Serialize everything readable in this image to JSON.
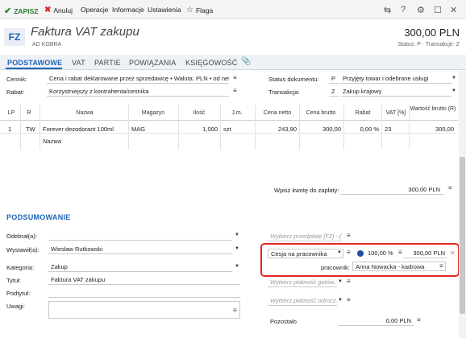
{
  "toolbar": {
    "save": "ZAPISZ",
    "cancel": "Anuluj",
    "operations": "Operacje",
    "info": "Informacje",
    "settings": "Ustawienia",
    "flag": "Flaga"
  },
  "header": {
    "badge": "FZ",
    "title": "Faktura VAT zakupu",
    "subtitle": "AD KOBRA",
    "total": "300,00 PLN",
    "status_line": "Status: P · Transakcje: Z"
  },
  "tabs": [
    "PODSTAWOWE",
    "VAT",
    "PARTIE",
    "POWIĄZANIA",
    "KSIĘGOWOŚĆ"
  ],
  "form": {
    "cennik_label": "Cennik:",
    "cennik_value": "Cena i rabat deklarowane przez sprzedawcę • Waluta: PLN • od net",
    "rabat_label": "Rabat:",
    "rabat_value": "Korzystniejszy z kontrahenta/cennika",
    "status_label": "Status dokumentu:",
    "status_code": "P",
    "status_value": "Przyjęty towar i odebrane usługi",
    "transakcja_label": "Transakcja:",
    "transakcja_code": "Z",
    "transakcja_value": "Zakup krajowy"
  },
  "grid": {
    "columns": [
      "LP",
      "R",
      "Nazwa",
      "Magazyn",
      "Ilość",
      "J.m.",
      "Cena netto",
      "Cena brutto",
      "Rabat",
      "VAT [%]",
      "Wartość brutto (R)"
    ],
    "row": {
      "lp": "1",
      "r": "TW",
      "nazwa": "Forever dezodorant 100ml",
      "magazyn": "MAG",
      "ilosc": "1,000",
      "jm": "szt",
      "netto": "243,90",
      "brutto": "300,00",
      "rabat": "0,00 %",
      "vat": "23",
      "wartosc": "300,00"
    },
    "new_row_placeholder": "Nazwa"
  },
  "payment_entry": {
    "label": "Wpisz kwotę do zapłaty:",
    "value": "300,00 PLN"
  },
  "summary": {
    "title": "PODSUMOWANIE",
    "odebral_label": "Odebrał(a):",
    "wystawil_label": "Wystawił(a):",
    "wystawil_value": "Wiesław Rutkowski",
    "kategoria_label": "Kategoria:",
    "kategoria_value": "Zakup",
    "tytul_label": "Tytuł:",
    "tytul_value": "Faktura VAT zakupu",
    "podtytul_label": "Podtytuł:",
    "uwagi_label": "Uwagi:",
    "prepayment_placeholder": "Wybierz przedpłatę [F2] - (...",
    "cesja_value": "Cesja na pracownika",
    "cesja_percent": "100,00 %",
    "cesja_amount": "300,00 PLN",
    "pracownik_label": "pracownik:",
    "pracownik_value": "Anna Nowacka - kadrowa",
    "cash_placeholder": "Wybierz płatność gotów...",
    "deferred_placeholder": "Wybierz płatność odrocz...",
    "pozostalo_label": "Pozostało",
    "pozostalo_value": "0,00 PLN"
  }
}
